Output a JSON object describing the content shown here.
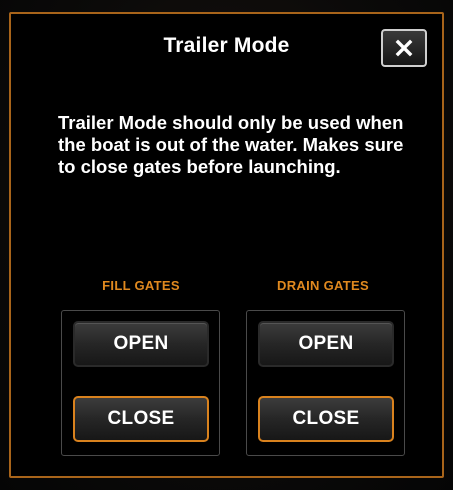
{
  "dialog": {
    "title": "Trailer Mode",
    "close_icon": "close-x-icon",
    "message": "Trailer Mode should only be used when the boat is out  of the water. Makes sure to close gates before launching."
  },
  "fill_gates": {
    "label": "FILL GATES",
    "open_label": "OPEN",
    "close_label": "CLOSE",
    "active": "CLOSE"
  },
  "drain_gates": {
    "label": "DRAIN GATES",
    "open_label": "OPEN",
    "close_label": "CLOSE",
    "active": "CLOSE"
  },
  "colors": {
    "accent": "#e0891f",
    "border_accent": "#a8641a",
    "background": "#000000",
    "text": "#ffffff"
  }
}
